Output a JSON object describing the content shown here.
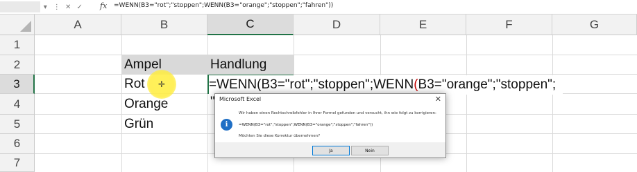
{
  "formula_bar": {
    "controls": [
      "▾",
      "⋮",
      "✕",
      "✓"
    ],
    "fx_label": "fx",
    "text": "=WENN(B3=\"rot\";\"stoppen\";WENN(B3=\"orange\";\"stoppen\";\"fahren\"))"
  },
  "columns": [
    "A",
    "B",
    "C",
    "D",
    "E",
    "F",
    "G"
  ],
  "rows": [
    "1",
    "2",
    "3",
    "4",
    "5",
    "6",
    "7"
  ],
  "cells": {
    "B2": "Ampel",
    "C2": "Handlung",
    "B3": "Rot",
    "B4": "Orange",
    "B5": "Grün"
  },
  "editing": {
    "part1": "=WENN(B3=\"rot\";\"stoppen\";WENN",
    "paren": "(",
    "part2": "B3=\"orange\";\"stoppen\";",
    "line2": "\""
  },
  "dialog": {
    "title": "Microsoft Excel",
    "close": "✕",
    "message": "Wir haben einen Rechtschreibfehler in Ihrer Formel gefunden und versucht, ihn wie folgt zu korrigieren:",
    "icon_glyph": "i",
    "formula": "=WENN(B3=\"rot\";\"stoppen\";WENN(B3=\"orange\";\"stoppen\";\"fahren\"))",
    "question": "Möchten Sie diese Korrektur übernehmen?",
    "yes_label": "Ja",
    "no_label": "Nein"
  },
  "colors": {
    "accent": "#217346",
    "header_fill": "#d9d9d9",
    "info_icon": "#1f6fc5",
    "paren_red": "#c00000"
  }
}
